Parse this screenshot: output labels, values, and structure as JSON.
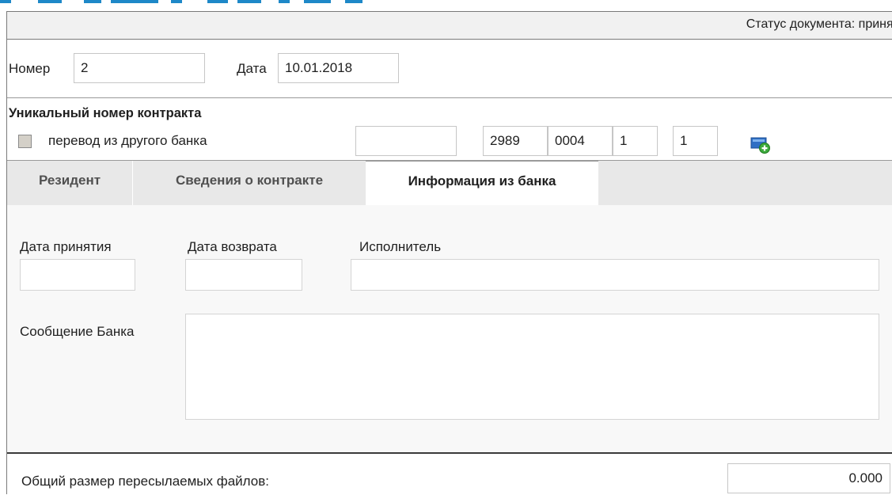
{
  "status": {
    "text": "Статус документа: принят"
  },
  "document": {
    "number_label": "Номер",
    "number_value": "2",
    "date_label": "Дата",
    "date_value": "10.01.2018"
  },
  "contract": {
    "title": "Уникальный номер контракта",
    "transfer_label": "перевод из другого банка",
    "transfer_checked": false,
    "parts": [
      "",
      "2989",
      "0004",
      "1",
      "1"
    ],
    "add_icon": "add-record-icon"
  },
  "tabs": [
    {
      "label": "Резидент",
      "active": false
    },
    {
      "label": "Сведения о контракте",
      "active": false
    },
    {
      "label": "Информация из банка",
      "active": true
    }
  ],
  "bank_info": {
    "acceptance_date_label": "Дата принятия",
    "acceptance_date_value": "",
    "return_date_label": "Дата возврата",
    "return_date_value": "",
    "executor_label": "Исполнитель",
    "executor_value": "",
    "message_label": "Сообщение Банка",
    "message_value": ""
  },
  "footer": {
    "files_size_label": "Общий размер пересылаемых файлов:",
    "files_size_value": "0.000"
  },
  "colors": {
    "accent_blue": "#1e88c8",
    "status_bar_bg": "#f1f1f1",
    "tab_bar_bg": "#e8e8e8",
    "panel_bg": "#f8f8f8",
    "checkbox_bg": "#d4d0c8"
  }
}
